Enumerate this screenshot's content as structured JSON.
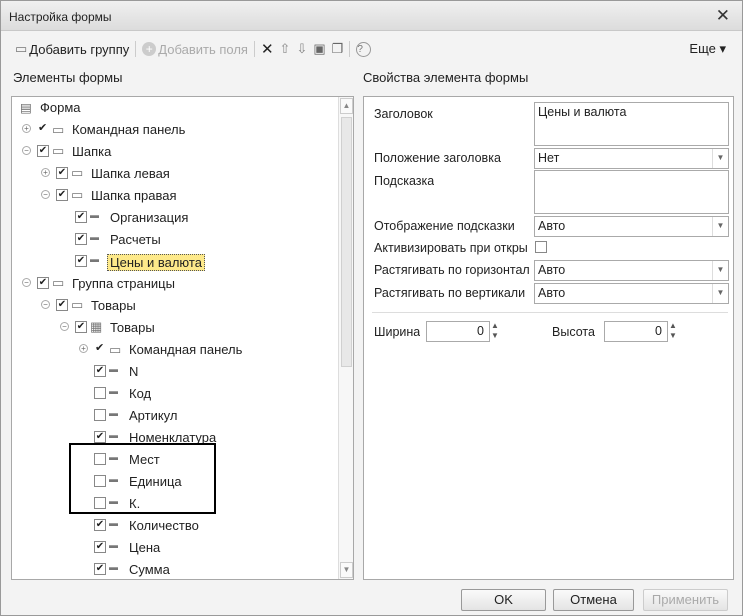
{
  "window": {
    "title": "Настройка формы",
    "close_icon": "close-icon"
  },
  "toolbar": {
    "add_group": "Добавить группу",
    "add_fields": "Добавить поля",
    "more": "Еще ▾"
  },
  "left": {
    "header": "Элементы формы"
  },
  "right": {
    "header": "Свойства элемента формы"
  },
  "tree": [
    {
      "label": "Форма",
      "level": 0,
      "exp": "",
      "check": "",
      "icon": "form"
    },
    {
      "label": "Командная панель",
      "level": 1,
      "exp": "+",
      "check": "tick",
      "icon": "cmd"
    },
    {
      "label": "Шапка",
      "level": 1,
      "exp": "-",
      "check": "on",
      "icon": "folder"
    },
    {
      "label": "Шапка левая",
      "level": 2,
      "exp": "+",
      "check": "on",
      "icon": "folder"
    },
    {
      "label": "Шапка правая",
      "level": 2,
      "exp": "-",
      "check": "on",
      "icon": "folder"
    },
    {
      "label": "Организация",
      "level": 3,
      "exp": "",
      "check": "on",
      "icon": "field"
    },
    {
      "label": "Расчеты",
      "level": 3,
      "exp": "",
      "check": "on",
      "icon": "field"
    },
    {
      "label": "Цены и валюта",
      "level": 3,
      "exp": "",
      "check": "on",
      "icon": "field",
      "selected": true
    },
    {
      "label": "Группа страницы",
      "level": 1,
      "exp": "-",
      "check": "on",
      "icon": "folder"
    },
    {
      "label": "Товары",
      "level": 2,
      "exp": "-",
      "check": "on",
      "icon": "folder"
    },
    {
      "label": "Товары",
      "level": 3,
      "exp": "-",
      "check": "on",
      "icon": "table"
    },
    {
      "label": "Командная панель",
      "level": 4,
      "exp": "+",
      "check": "tick",
      "icon": "cmd"
    },
    {
      "label": "N",
      "level": 4,
      "exp": "",
      "check": "on",
      "icon": "field"
    },
    {
      "label": "Код",
      "level": 4,
      "exp": "",
      "check": "off",
      "icon": "field"
    },
    {
      "label": "Артикул",
      "level": 4,
      "exp": "",
      "check": "off",
      "icon": "field"
    },
    {
      "label": "Номенклатура",
      "level": 4,
      "exp": "",
      "check": "on",
      "icon": "field"
    },
    {
      "label": "Мест",
      "level": 4,
      "exp": "",
      "check": "off",
      "icon": "field"
    },
    {
      "label": "Единица",
      "level": 4,
      "exp": "",
      "check": "off",
      "icon": "field"
    },
    {
      "label": "К.",
      "level": 4,
      "exp": "",
      "check": "off",
      "icon": "field"
    },
    {
      "label": "Количество",
      "level": 4,
      "exp": "",
      "check": "on",
      "icon": "field"
    },
    {
      "label": "Цена",
      "level": 4,
      "exp": "",
      "check": "on",
      "icon": "field"
    },
    {
      "label": "Сумма",
      "level": 4,
      "exp": "",
      "check": "on",
      "icon": "field"
    }
  ],
  "props": {
    "title_label": "Заголовок",
    "title_value": "Цены и валюта",
    "title_pos_label": "Положение заголовка",
    "title_pos_value": "Нет",
    "tooltip_label": "Подсказка",
    "tooltip_value": "",
    "tooltip_display_label": "Отображение подсказки",
    "tooltip_display_value": "Авто",
    "activate_label": "Активизировать при откры",
    "activate_checked": false,
    "stretch_h_label": "Растягивать по горизонтал",
    "stretch_h_value": "Авто",
    "stretch_v_label": "Растягивать по вертикали",
    "stretch_v_value": "Авто",
    "width_label": "Ширина",
    "width_value": "0",
    "height_label": "Высота",
    "height_value": "0"
  },
  "buttons": {
    "ok": "OK",
    "cancel": "Отмена",
    "apply": "Применить"
  }
}
